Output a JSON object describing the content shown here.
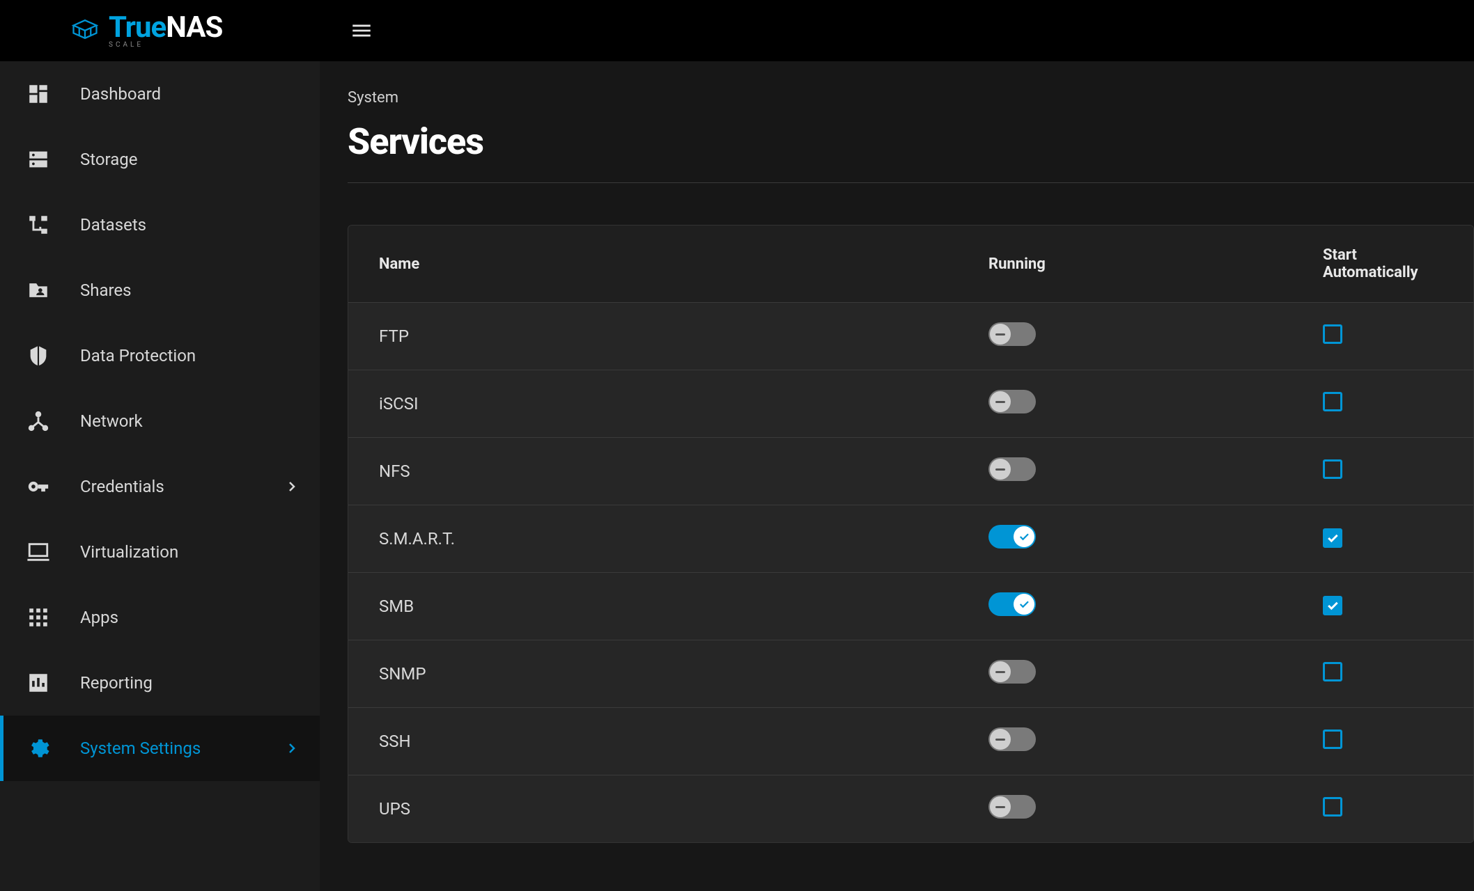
{
  "brand": {
    "name_part1": "True",
    "name_part2": "NAS",
    "subtitle": "SCALE"
  },
  "sidebar": {
    "items": [
      {
        "id": "dashboard",
        "label": "Dashboard",
        "icon": "dashboard",
        "expandable": false,
        "active": false
      },
      {
        "id": "storage",
        "label": "Storage",
        "icon": "dns",
        "expandable": false,
        "active": false
      },
      {
        "id": "datasets",
        "label": "Datasets",
        "icon": "account-tree",
        "expandable": false,
        "active": false
      },
      {
        "id": "shares",
        "label": "Shares",
        "icon": "folder-shared",
        "expandable": false,
        "active": false
      },
      {
        "id": "data-protection",
        "label": "Data Protection",
        "icon": "security",
        "expandable": false,
        "active": false
      },
      {
        "id": "network",
        "label": "Network",
        "icon": "device-hub",
        "expandable": false,
        "active": false
      },
      {
        "id": "credentials",
        "label": "Credentials",
        "icon": "vpn-key",
        "expandable": true,
        "active": false
      },
      {
        "id": "virtualization",
        "label": "Virtualization",
        "icon": "computer",
        "expandable": false,
        "active": false
      },
      {
        "id": "apps",
        "label": "Apps",
        "icon": "apps",
        "expandable": false,
        "active": false
      },
      {
        "id": "reporting",
        "label": "Reporting",
        "icon": "bar-chart",
        "expandable": false,
        "active": false
      },
      {
        "id": "system-settings",
        "label": "System Settings",
        "icon": "settings",
        "expandable": true,
        "active": true
      }
    ]
  },
  "header": {
    "breadcrumb": "System",
    "title": "Services"
  },
  "table": {
    "columns": {
      "name": "Name",
      "running": "Running",
      "auto": "Start Automatically"
    },
    "services": [
      {
        "name": "FTP",
        "running": false,
        "auto": false
      },
      {
        "name": "iSCSI",
        "running": false,
        "auto": false
      },
      {
        "name": "NFS",
        "running": false,
        "auto": false
      },
      {
        "name": "S.M.A.R.T.",
        "running": true,
        "auto": true
      },
      {
        "name": "SMB",
        "running": true,
        "auto": true
      },
      {
        "name": "SNMP",
        "running": false,
        "auto": false
      },
      {
        "name": "SSH",
        "running": false,
        "auto": false
      },
      {
        "name": "UPS",
        "running": false,
        "auto": false
      }
    ]
  }
}
